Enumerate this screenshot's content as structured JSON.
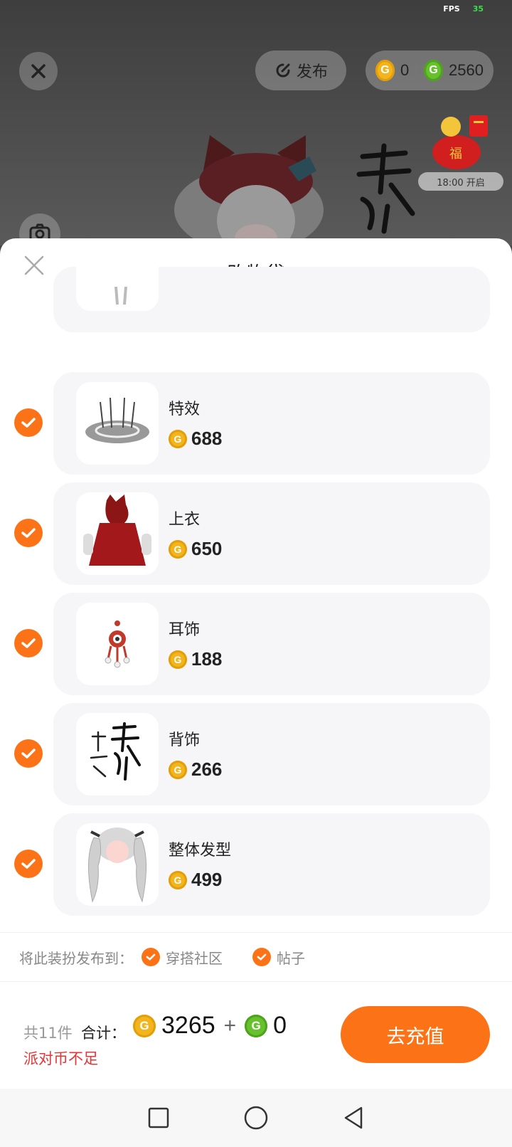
{
  "status": {
    "fps_label": "FPS",
    "fps_value": "35"
  },
  "top_bar": {
    "publish_label": "发布",
    "currencies": {
      "gold_balance": "0",
      "green_balance": "2560"
    }
  },
  "event": {
    "time_label": "18:00 开启"
  },
  "sheet": {
    "title": "购物袋",
    "items": [
      {
        "name": "特效",
        "price": "688"
      },
      {
        "name": "上衣",
        "price": "650"
      },
      {
        "name": "耳饰",
        "price": "188"
      },
      {
        "name": "背饰",
        "price": "266"
      },
      {
        "name": "整体发型",
        "price": "499"
      }
    ]
  },
  "publish_to": {
    "label": "将此装扮发布到：",
    "options": [
      {
        "label": "穿搭社区"
      },
      {
        "label": "帖子"
      }
    ]
  },
  "summary": {
    "count": "共11件",
    "total_label": "合计：",
    "gold_total": "3265",
    "plus": "+",
    "green_total": "0",
    "warning": "派对币不足",
    "recharge_label": "去充值"
  },
  "colors": {
    "accent": "#fb7316",
    "gold": "#f2b51e",
    "green": "#66c12c",
    "warning": "#e53535"
  },
  "icons": [
    "close-icon",
    "publish-icon",
    "gold-coin-icon",
    "green-coin-icon",
    "camera-icon",
    "check-icon",
    "nav-square-icon",
    "nav-circle-icon",
    "nav-back-icon"
  ]
}
